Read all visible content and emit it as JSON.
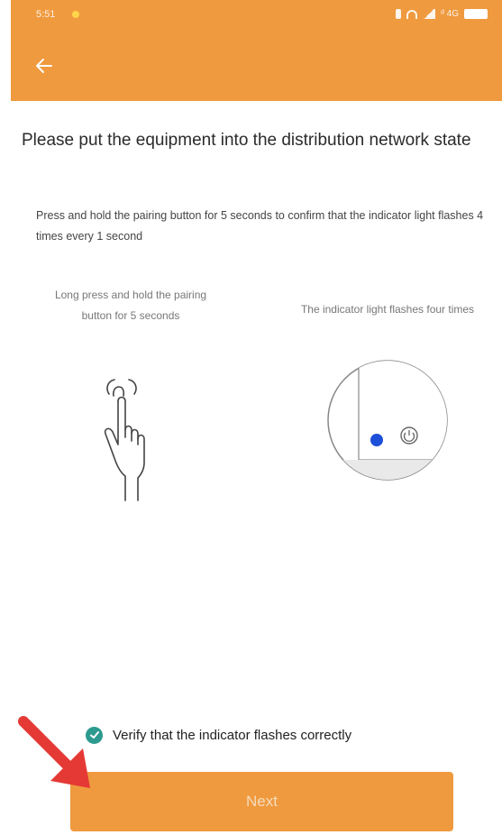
{
  "status_bar": {
    "time": "5:51",
    "right_text": "ᵈ 4G"
  },
  "header": {
    "back_icon": "arrow-left-icon",
    "accent_color": "#ef9a3e"
  },
  "main": {
    "title": "Please put the equipment into the distribution network state",
    "subtitle": "Press and hold the pairing button for 5 seconds to confirm that the indicator light flashes 4 times every 1 second",
    "left_caption": "Long press and hold the pairing button for 5 seconds",
    "right_caption": "The indicator light flashes four times",
    "left_illustration_icon": "finger-press-icon",
    "right_illustration_icon": "indicator-light-icon"
  },
  "footer": {
    "verify_label": "Verify that the indicator flashes correctly",
    "verify_checked": true,
    "next_label": "Next",
    "check_color": "#2d9a8f"
  }
}
